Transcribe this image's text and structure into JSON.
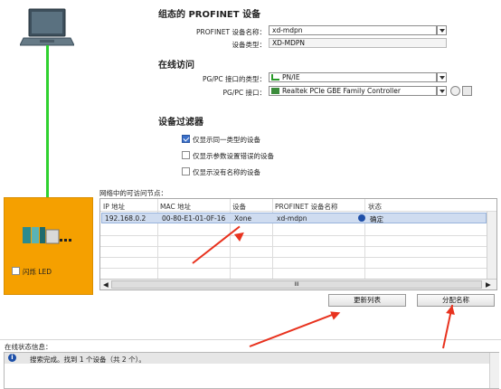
{
  "config": {
    "title": "组态的 PROFINET 设备",
    "device_name_label": "PROFINET 设备名称：",
    "device_name_value": "xd-mdpn",
    "device_type_label": "设备类型：",
    "device_type_value": "XD-MDPN"
  },
  "online": {
    "title": "在线访问",
    "iface_type_label": "PG/PC 接口的类型：",
    "iface_type_value": "PN/IE",
    "iface_label": "PG/PC 接口：",
    "iface_value": "Realtek PCIe GBE Family Controller"
  },
  "filter": {
    "title": "设备过滤器",
    "options": [
      {
        "label": "仅显示同一类型的设备",
        "checked": true
      },
      {
        "label": "仅显示参数设置错误的设备",
        "checked": false
      },
      {
        "label": "仅显示没有名称的设备",
        "checked": false
      }
    ]
  },
  "table": {
    "caption": "网络中的可访问节点：",
    "headers": [
      "IP 地址",
      "MAC 地址",
      "设备",
      "PROFINET 设备名称",
      "状态"
    ],
    "rows": [
      {
        "ip": "192.168.0.2",
        "mac": "00-80-E1-01-0F-16",
        "device": "Xone",
        "name": "xd-mdpn",
        "status": "确定"
      }
    ],
    "scroll_mark": "III"
  },
  "buttons": {
    "update_list": "更新列表",
    "assign_name": "分配名称"
  },
  "left_panel": {
    "flash_led": "闪烁 LED",
    "flash_checked": false
  },
  "status": {
    "title": "在线状态信息：",
    "message": "搜索完成。找到 1 个设备（共 2 个）。"
  },
  "colors": {
    "orange": "#f5a000",
    "link_green": "#2fd12f",
    "arrow_red": "#e8321e",
    "row_selected": "#cfdcf0"
  }
}
